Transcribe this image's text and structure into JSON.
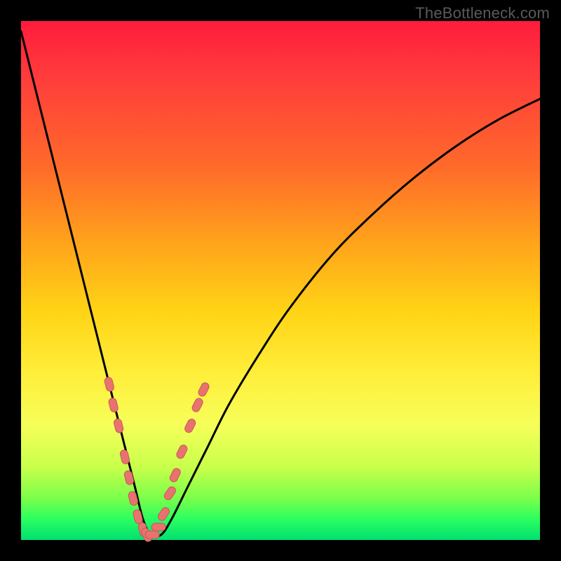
{
  "watermark": "TheBottleneck.com",
  "colors": {
    "frame": "#000000",
    "curve": "#000000",
    "marker_fill": "#e9726f",
    "marker_stroke": "#c45a58"
  },
  "chart_data": {
    "type": "line",
    "title": "",
    "xlabel": "",
    "ylabel": "",
    "xlim": [
      0,
      100
    ],
    "ylim": [
      0,
      100
    ],
    "grid": false,
    "legend": false,
    "series": [
      {
        "name": "bottleneck-curve",
        "x": [
          0,
          2,
          4,
          6,
          8,
          10,
          12,
          14,
          16,
          18,
          20,
          22,
          23.5,
          25,
          27,
          29,
          32,
          36,
          40,
          46,
          52,
          60,
          68,
          76,
          84,
          92,
          100
        ],
        "y": [
          98,
          90,
          82,
          74,
          66,
          58,
          50,
          42,
          34,
          26,
          18,
          10,
          4,
          1,
          1,
          4,
          10,
          18,
          26,
          36,
          45,
          55,
          63,
          70,
          76,
          81,
          85
        ]
      }
    ],
    "markers": [
      {
        "x": 17.0,
        "y": 30
      },
      {
        "x": 17.8,
        "y": 26
      },
      {
        "x": 18.8,
        "y": 22
      },
      {
        "x": 20.0,
        "y": 16
      },
      {
        "x": 20.8,
        "y": 12
      },
      {
        "x": 21.6,
        "y": 8
      },
      {
        "x": 22.5,
        "y": 4.5
      },
      {
        "x": 23.5,
        "y": 2
      },
      {
        "x": 24.2,
        "y": 1
      },
      {
        "x": 25.3,
        "y": 1
      },
      {
        "x": 26.5,
        "y": 2.5
      },
      {
        "x": 27.5,
        "y": 5
      },
      {
        "x": 28.7,
        "y": 9
      },
      {
        "x": 29.7,
        "y": 12.5
      },
      {
        "x": 31.0,
        "y": 17
      },
      {
        "x": 32.6,
        "y": 22
      },
      {
        "x": 34.0,
        "y": 26
      },
      {
        "x": 35.2,
        "y": 29
      }
    ]
  }
}
